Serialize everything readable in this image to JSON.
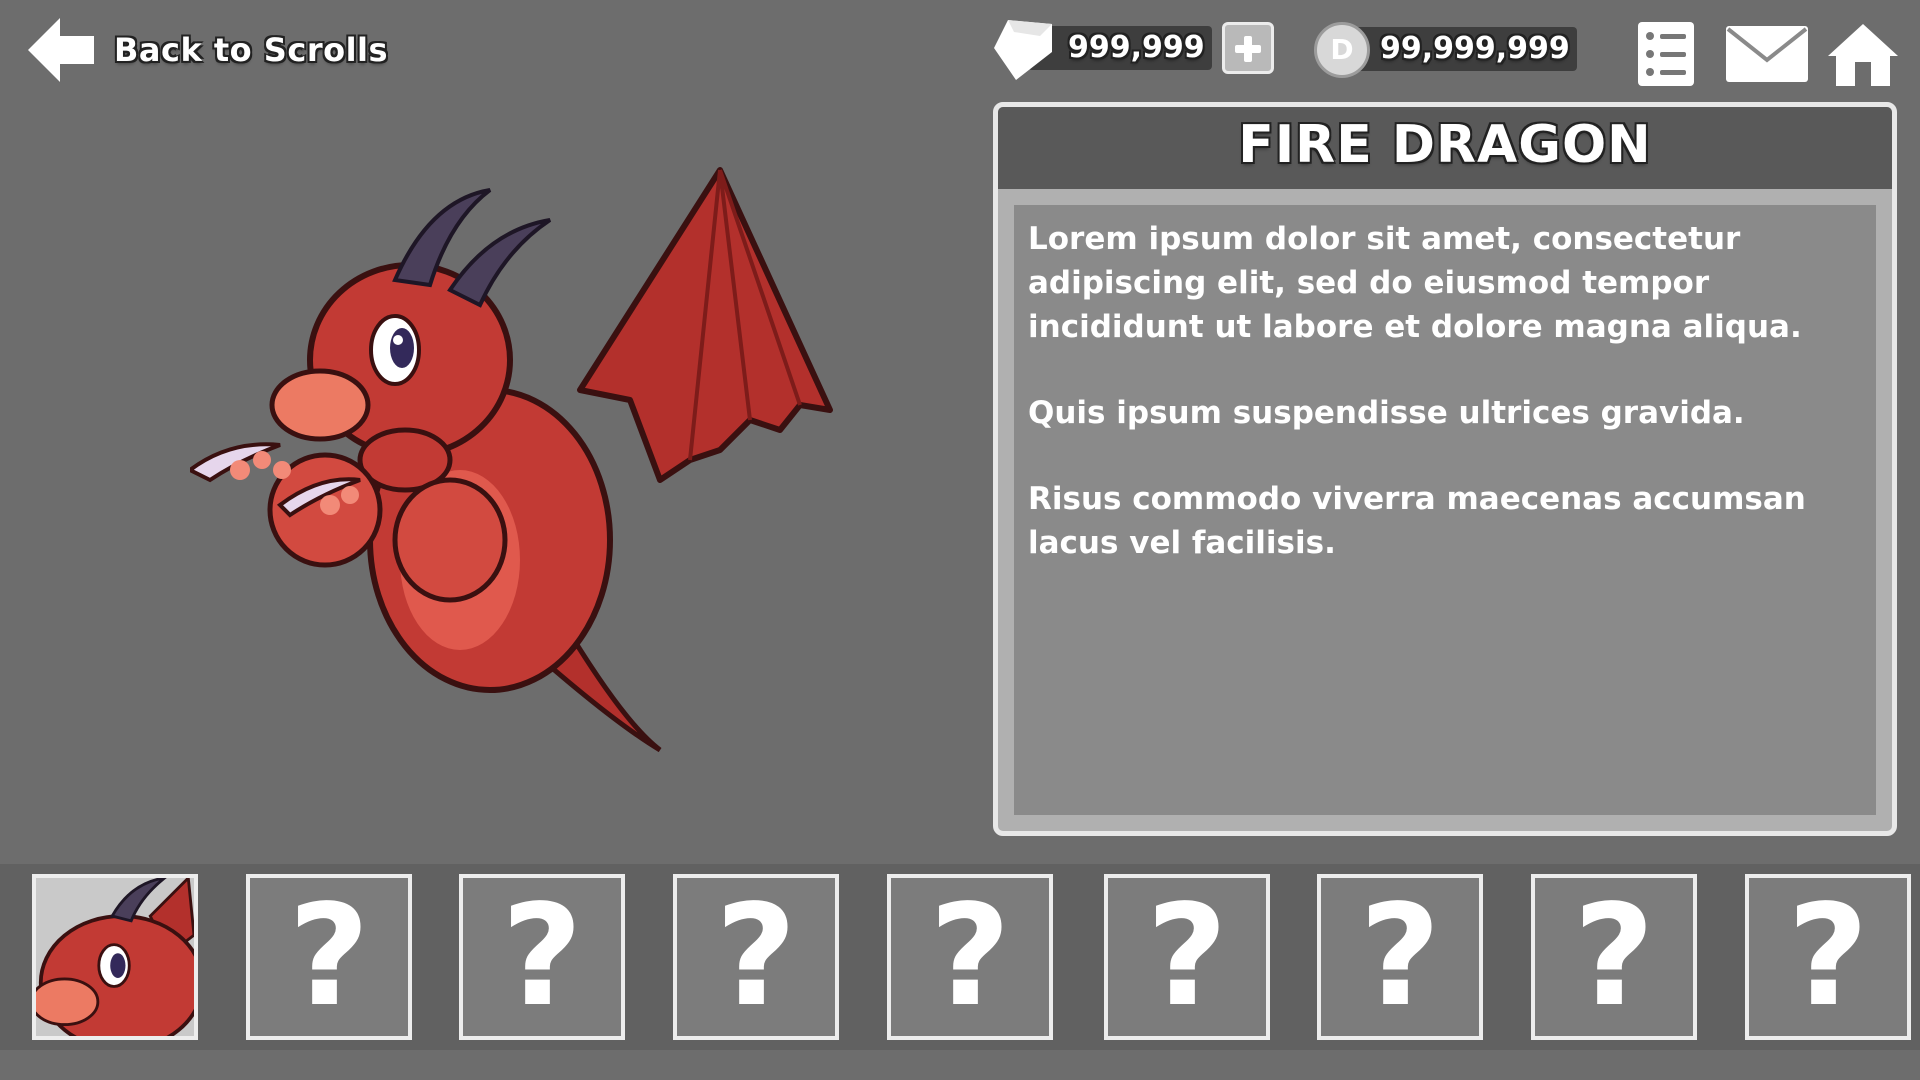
{
  "header": {
    "back_label": "Back to Scrolls",
    "gems": "999,999",
    "coins": "99,999,999",
    "coin_letter": "D",
    "icons": [
      "back-arrow-icon",
      "gem-icon",
      "plus-icon",
      "coin-icon",
      "task-list-icon",
      "mail-icon",
      "home-icon"
    ]
  },
  "creature": {
    "name": "FIRE DRAGON",
    "description": [
      "Lorem ipsum dolor sit amet, consectetur adipiscing elit, sed do eiusmod tempor incididunt ut labore et dolore magna aliqua.",
      "Quis ipsum suspendisse ultrices gravida.",
      "Risus commodo viverra maecenas accumsan lacus vel facilisis."
    ]
  },
  "collection": {
    "locked_symbol": "?",
    "slots": [
      "fire-dragon",
      "locked",
      "locked",
      "locked",
      "locked",
      "locked",
      "locked",
      "locked",
      "locked"
    ]
  },
  "colors": {
    "background": "#6d6d6d",
    "dragon_body": "#c23a34",
    "dragon_belly": "#e0594d",
    "horn": "#4a3f5a"
  }
}
